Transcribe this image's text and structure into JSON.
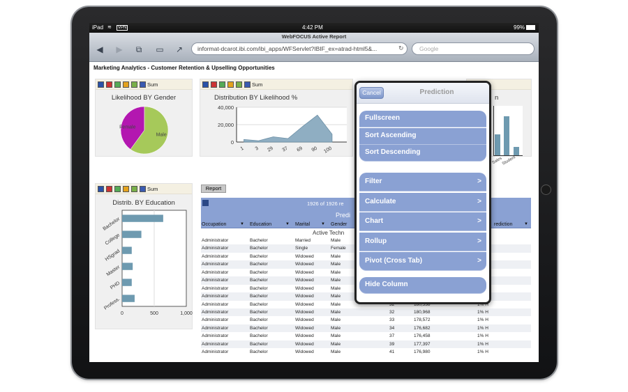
{
  "statusbar": {
    "device": "iPad",
    "time": "4:42 PM",
    "battery": "99%"
  },
  "browser": {
    "title": "WebFOCUS Active Report",
    "url": "informat-dcarot.ibi.com/ibi_apps/WFServlet?IBIF_ex=atrad-html5&...",
    "search_placeholder": "Google"
  },
  "page": {
    "title": "Marketing Analytics - Customer Retention & Upselling Opportunities"
  },
  "toolbar": {
    "sum_label": "Sum"
  },
  "panels": {
    "gender": {
      "title": "Likelihood BY Gender"
    },
    "distribution": {
      "title": "Distribution BY Likelihood %"
    },
    "education": {
      "title": "Distrib. BY Education"
    },
    "hidden": {
      "title_suffix": "n",
      "labels": [
        "Sales",
        "Student"
      ]
    }
  },
  "chart_data": [
    {
      "type": "pie",
      "title": "Likelihood BY Gender",
      "labels": [
        "Female",
        "Male"
      ],
      "values": [
        40,
        60
      ],
      "colors": [
        "#b317b0",
        "#a6c95a"
      ]
    },
    {
      "type": "area",
      "title": "Distribution BY Likelihood %",
      "x": [
        "1",
        "3",
        "29",
        "37",
        "69",
        "90",
        "100"
      ],
      "y": [
        3000,
        1500,
        6000,
        4000,
        18000,
        31000,
        9000
      ],
      "ylim": [
        0,
        40000
      ],
      "yticks": [
        "40,000",
        "20,000",
        "0"
      ],
      "color": "#8faec2"
    },
    {
      "type": "bar",
      "title": "Distrib. BY Education",
      "categories": [
        "Bachelor",
        "College",
        "HSgrad",
        "Master",
        "PHD",
        "Profess."
      ],
      "values": [
        640,
        300,
        150,
        165,
        150,
        195
      ],
      "xlim": [
        0,
        1000
      ],
      "xticks": [
        "0",
        "500",
        "1,000"
      ],
      "color": "#6e9ab0"
    }
  ],
  "report": {
    "tab_label": "Report",
    "count_text": "1926 of 1926 re",
    "group_label": "Predi",
    "columns": [
      "Occupation",
      "Education",
      "Marital",
      "Gender",
      "rediction"
    ],
    "section_label": "Active Techn",
    "rows": [
      [
        "Administrator",
        "Bachelor",
        "Married",
        "Male",
        "",
        "",
        ""
      ],
      [
        "Administrator",
        "Bachelor",
        "Single",
        "Female",
        "",
        "",
        ""
      ],
      [
        "Administrator",
        "Bachelor",
        "Widowed",
        "Male",
        "",
        "",
        ""
      ],
      [
        "Administrator",
        "Bachelor",
        "Widowed",
        "Male",
        "",
        "",
        ""
      ],
      [
        "Administrator",
        "Bachelor",
        "Widowed",
        "Male",
        "",
        "",
        ""
      ],
      [
        "Administrator",
        "Bachelor",
        "Widowed",
        "Male",
        "",
        "",
        ""
      ],
      [
        "Administrator",
        "Bachelor",
        "Widowed",
        "Male",
        "",
        "",
        ""
      ],
      [
        "Administrator",
        "Bachelor",
        "Widowed",
        "Male",
        "",
        "",
        ""
      ],
      [
        "Administrator",
        "Bachelor",
        "Widowed",
        "Male",
        "32",
        "180,538",
        "1% H"
      ],
      [
        "Administrator",
        "Bachelor",
        "Widowed",
        "Male",
        "32",
        "180,968",
        "1% H"
      ],
      [
        "Administrator",
        "Bachelor",
        "Widowed",
        "Male",
        "33",
        "178,572",
        "1% H"
      ],
      [
        "Administrator",
        "Bachelor",
        "Widowed",
        "Male",
        "34",
        "176,682",
        "1% H"
      ],
      [
        "Administrator",
        "Bachelor",
        "Widowed",
        "Male",
        "37",
        "176,458",
        "1% H"
      ],
      [
        "Administrator",
        "Bachelor",
        "Widowed",
        "Male",
        "39",
        "177,397",
        "1% H"
      ],
      [
        "Administrator",
        "Bachelor",
        "Widowed",
        "Male",
        "41",
        "176,980",
        "1% H"
      ]
    ]
  },
  "popup": {
    "cancel_label": "Cancel",
    "title": "Prediction",
    "group1": [
      "Fullscreen",
      "Sort Ascending",
      "Sort Descending"
    ],
    "group2": [
      "Filter",
      "Calculate",
      "Chart",
      "Rollup",
      "Pivot (Cross Tab)"
    ],
    "group3": [
      "Hide Column"
    ],
    "arrow": ">"
  }
}
